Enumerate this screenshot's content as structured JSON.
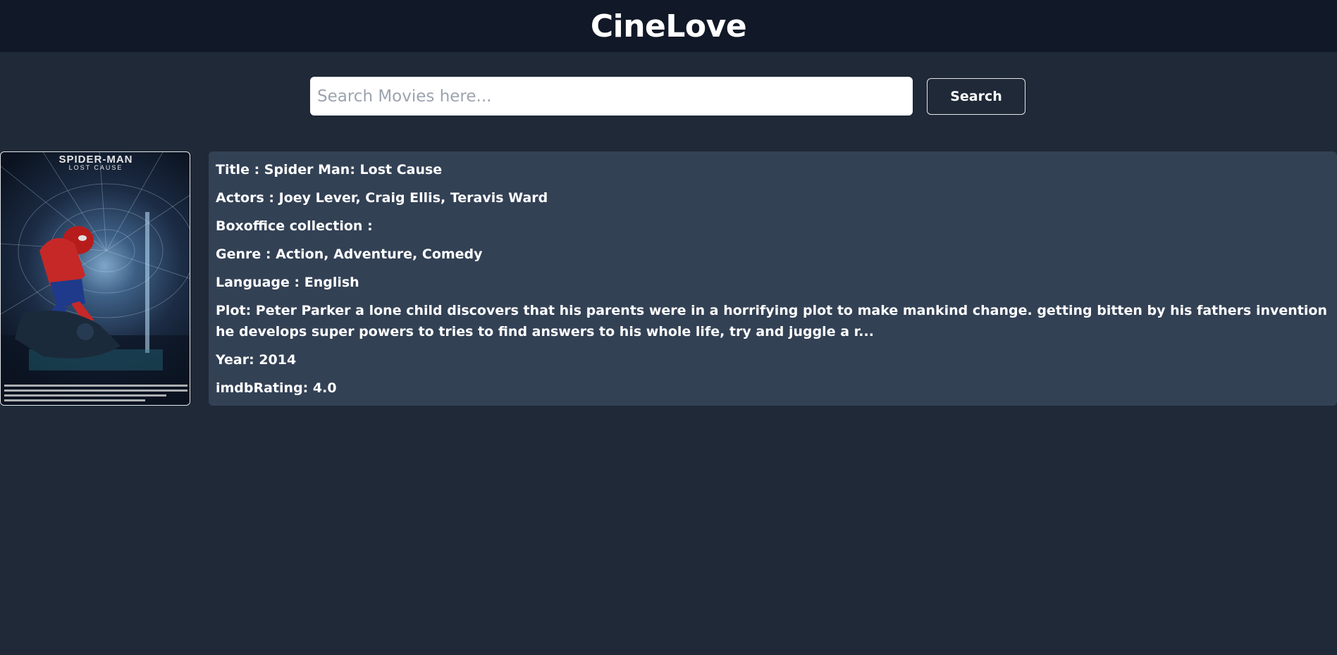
{
  "header": {
    "title": "CineLove"
  },
  "search": {
    "placeholder": "Search Movies here...",
    "value": "",
    "button_label": "Search"
  },
  "movie": {
    "poster": {
      "title_text": "SPIDER-MAN",
      "subtitle_text": "LOST CAUSE"
    },
    "title_label": "Title : ",
    "title": "Spider Man: Lost Cause",
    "actors_label": "Actors : ",
    "actors": "Joey Lever, Craig Ellis, Teravis Ward",
    "boxoffice_label": "Boxoffice collection : ",
    "boxoffice": "",
    "genre_label": "Genre : ",
    "genre": "Action, Adventure, Comedy",
    "language_label": "Language : ",
    "language": "English",
    "plot_label": "Plot: ",
    "plot": "Peter Parker a lone child discovers that his parents were in a horrifying plot to make mankind change. getting bitten by his fathers invention he develops super powers to tries to find answers to his whole life, try and juggle a r...",
    "year_label": "Year: ",
    "year": "2014",
    "rating_label": "imdbRating: ",
    "rating": "4.0"
  }
}
